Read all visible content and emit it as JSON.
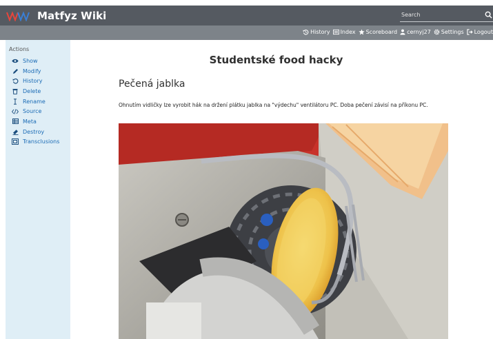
{
  "header": {
    "brand": "Matfyz Wiki",
    "search_placeholder": "Search"
  },
  "user_links": [
    {
      "label": "History",
      "icon": "history-icon"
    },
    {
      "label": "Index",
      "icon": "index-icon"
    },
    {
      "label": "Scoreboard",
      "icon": "star-icon"
    },
    {
      "label": "cernyj27",
      "icon": "user-icon"
    },
    {
      "label": "Settings",
      "icon": "gear-icon"
    },
    {
      "label": "Logout",
      "icon": "logout-icon"
    }
  ],
  "sidebar": {
    "title": "Actions",
    "items": [
      {
        "label": "Show",
        "icon": "eye-icon"
      },
      {
        "label": "Modify",
        "icon": "pencil-icon"
      },
      {
        "label": "History",
        "icon": "history-icon"
      },
      {
        "label": "Delete",
        "icon": "trash-icon"
      },
      {
        "label": "Rename",
        "icon": "text-cursor-icon"
      },
      {
        "label": "Source",
        "icon": "code-icon"
      },
      {
        "label": "Meta",
        "icon": "table-icon"
      },
      {
        "label": "Destroy",
        "icon": "eraser-icon"
      },
      {
        "label": "Transclusions",
        "icon": "transclusion-icon"
      }
    ]
  },
  "content": {
    "title": "Studentské food hacky",
    "section_heading": "Pečená jablka",
    "paragraph": "Ohnutím vidličky lze vyrobit hák na držení plátku jablka na \"výdechu\" ventilátoru PC. Doba pečení závisí na příkonu PC.",
    "image_alt": "Apple slice on a bent fork roasting at a PC fan exhaust"
  },
  "colors": {
    "topbar": "#555a61",
    "subbar": "#7d8389",
    "sidebar_bg": "#dfeef6",
    "link": "#1a6bb5",
    "logo_red": "#e8453c",
    "logo_blue": "#3a7fd5"
  }
}
